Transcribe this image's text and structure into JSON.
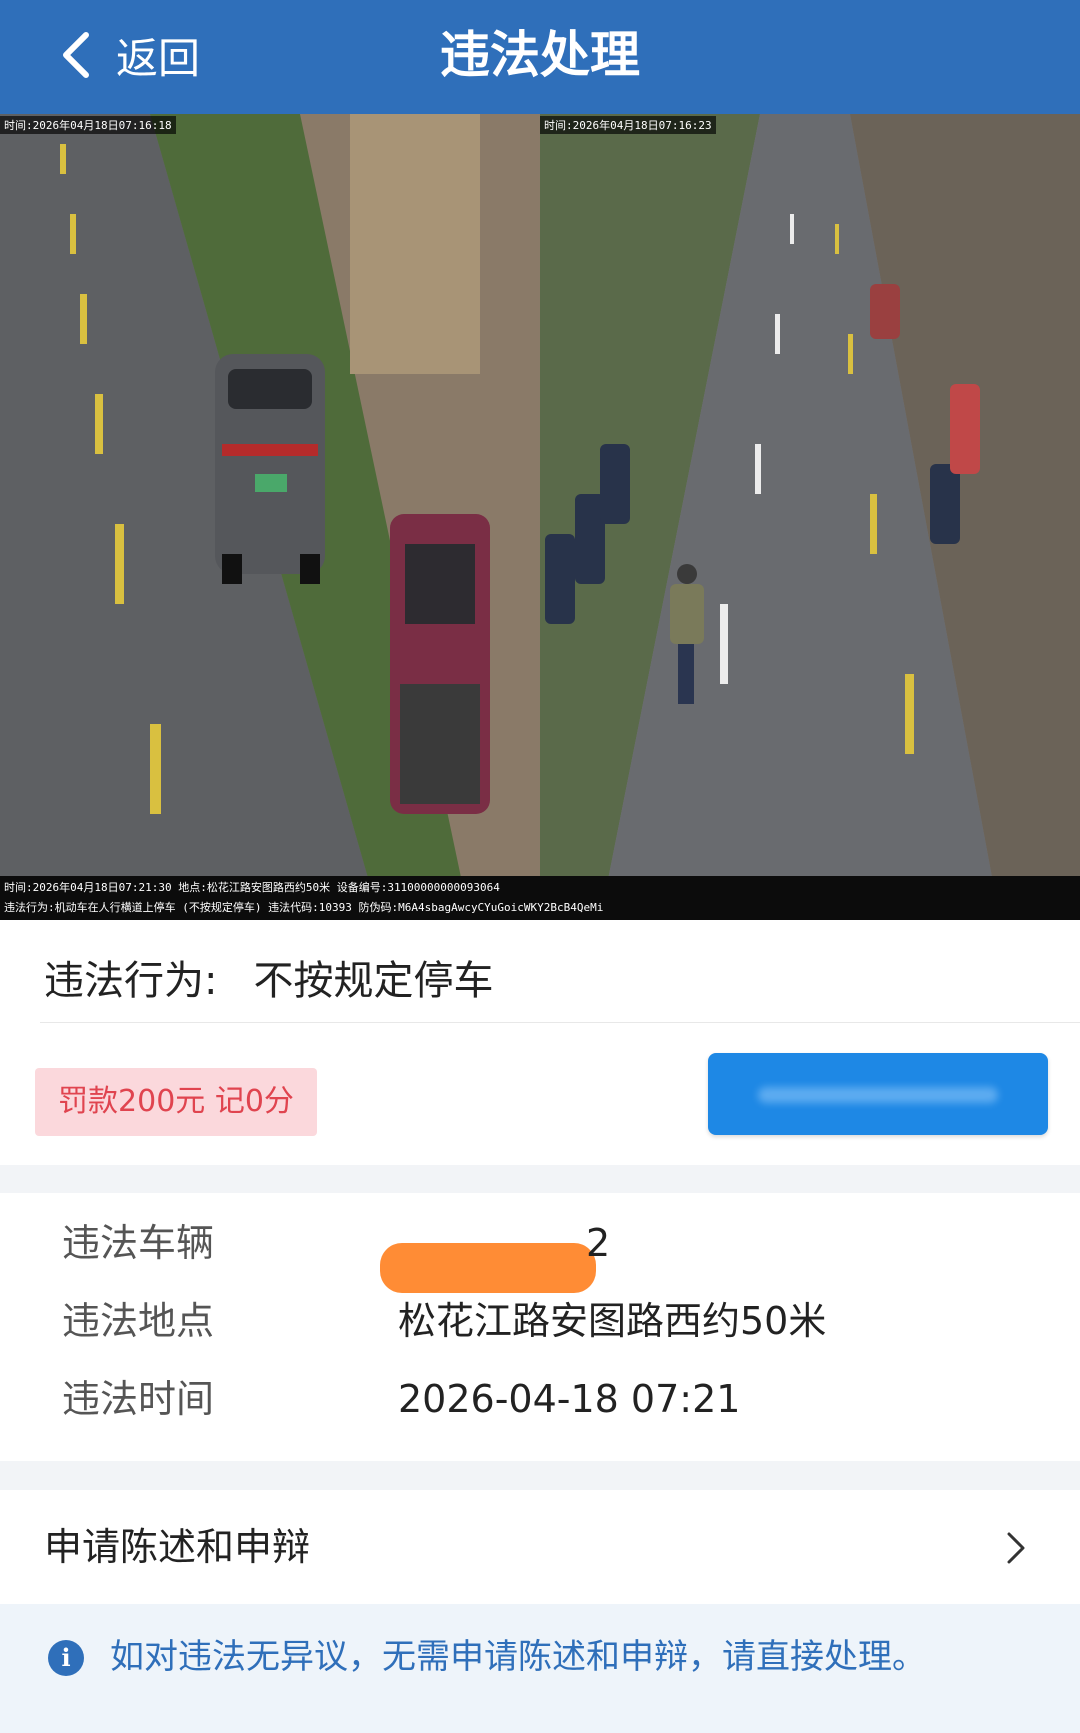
{
  "header": {
    "back_label": "返回",
    "title": "违法处理"
  },
  "photo": {
    "stamp_left": "时间:2026年04月18日07:16:18",
    "stamp_right": "时间:2026年04月18日07:16:23",
    "caption_line1": "时间:2026年04月18日07:21:30 地点:松花江路安图路西约50米 设备编号:31100000000093064",
    "caption_line2": "违法行为:机动车在人行横道上停车 (不按规定停车) 违法代码:10393 防伪码:M6A4sbagAwcyCYuGoicWKY2BcB4QeMi",
    "page_count": 2,
    "active_page": 1
  },
  "violation": {
    "behavior_label": "违法行为:",
    "behavior_value": "不按规定停车",
    "fine_badge": "罚款200元 记0分",
    "accent_color": "#1e88e5",
    "badge_color": "#e0444f"
  },
  "details": {
    "vehicle_label": "违法车辆",
    "vehicle_value_tail": "2",
    "location_label": "违法地点",
    "location_value": "松花江路安图路西约50米",
    "time_label": "违法时间",
    "time_value": "2026-04-18 07:21"
  },
  "appeal": {
    "label": "申请陈述和申辩",
    "icon": "chevron-right-icon"
  },
  "notice": {
    "icon": "info-icon",
    "text": "如对违法无异议，无需申请陈述和申辩，请直接处理。"
  }
}
